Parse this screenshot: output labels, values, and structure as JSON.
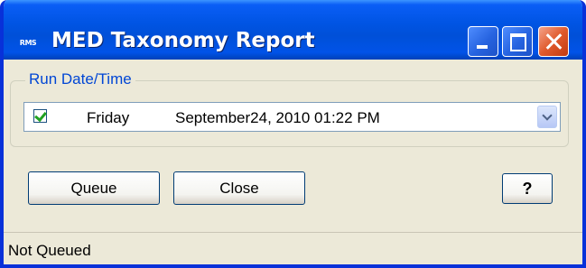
{
  "window": {
    "title": "MED Taxonomy Report",
    "app_icon_text": "RMS"
  },
  "run_group": {
    "label": "Run Date/Time",
    "checked": true,
    "day": "Friday",
    "datetime": "September24, 2010  01:22 PM"
  },
  "buttons": {
    "queue": "Queue",
    "close": "Close",
    "help": "?"
  },
  "status": {
    "text": "Not Queued"
  },
  "colors": {
    "title_bar": "#0054e3",
    "group_label": "#0046d5",
    "face": "#ece9d8",
    "close_button": "#e05a2c",
    "check_mark": "#21a121"
  }
}
